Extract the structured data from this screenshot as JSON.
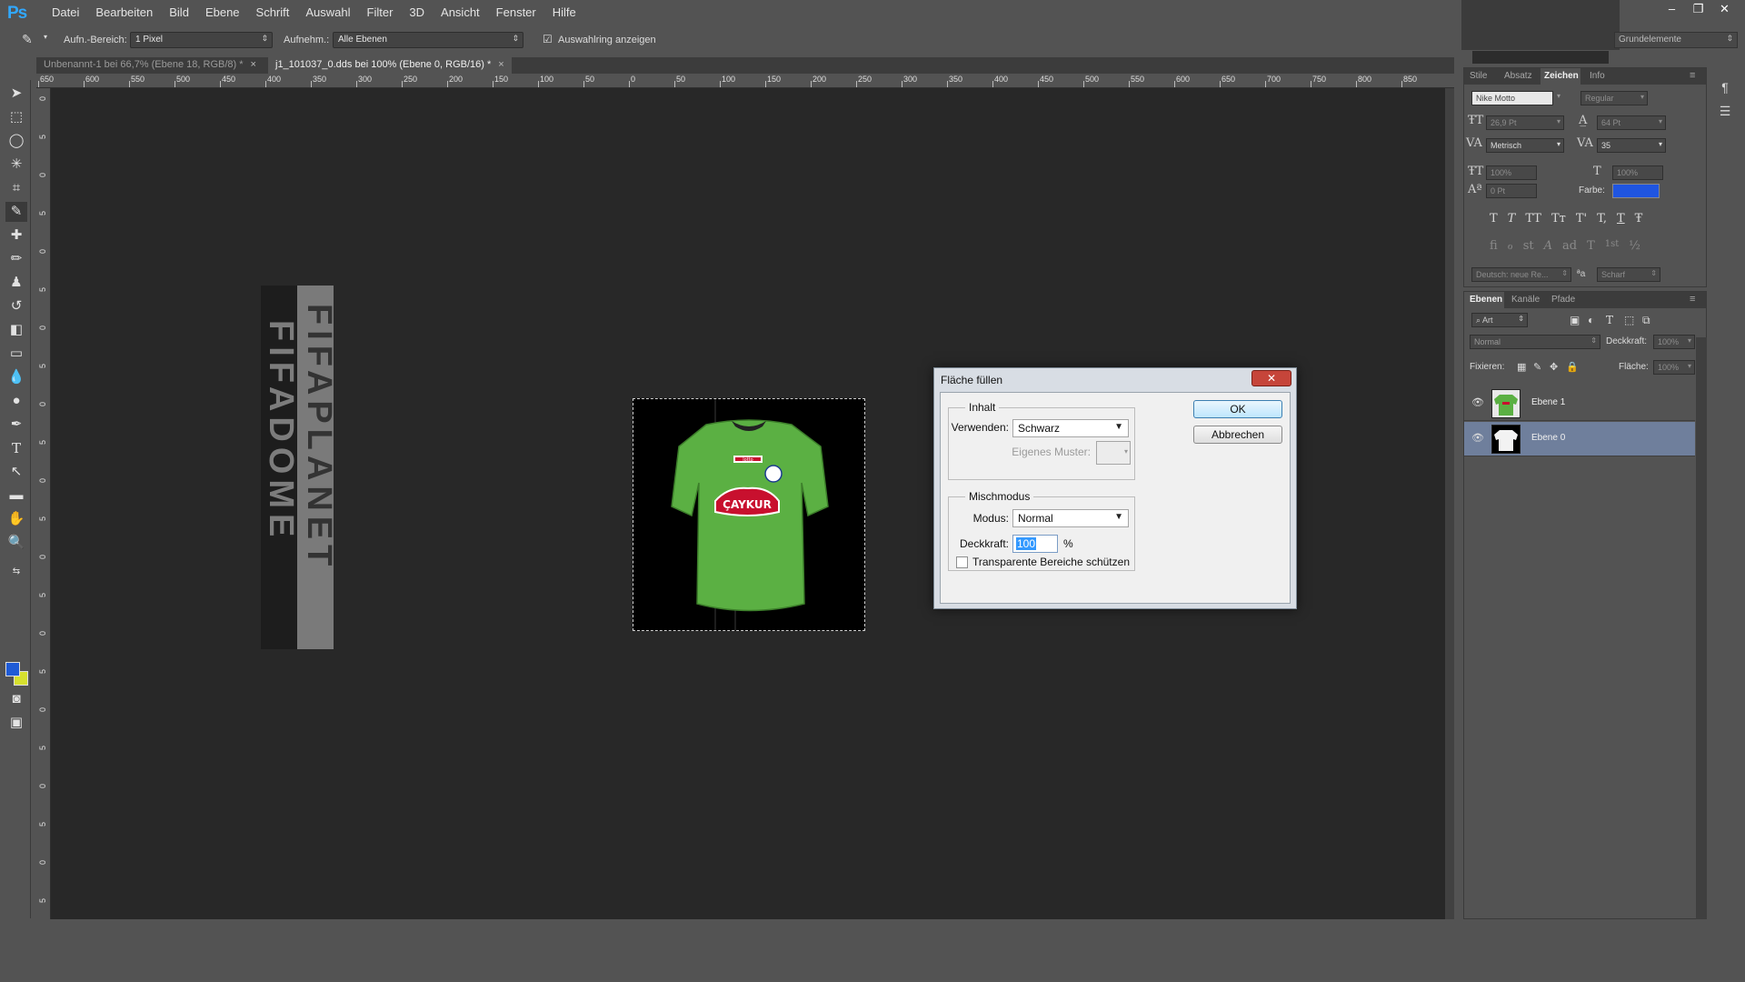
{
  "app": {
    "logo": "Ps"
  },
  "menu": [
    "Datei",
    "Bearbeiten",
    "Bild",
    "Ebene",
    "Schrift",
    "Auswahl",
    "Filter",
    "3D",
    "Ansicht",
    "Fenster",
    "Hilfe"
  ],
  "window_controls": [
    "–",
    "❐",
    "✕"
  ],
  "options": {
    "tool_icon": "eyedropper-icon",
    "sample_size_label": "Aufn.-Bereich:",
    "sample_size_value": "1 Pixel",
    "sample_label": "Aufnehm.:",
    "sample_value": "Alle Ebenen",
    "show_ring_label": "Auswahlring anzeigen",
    "workspace": "Grundelemente"
  },
  "doc_tabs": [
    {
      "label": "Unbenannt-1 bei 66,7% (Ebene 18, RGB/8) *",
      "close": "×"
    },
    {
      "label": "j1_101037_0.dds bei 100% (Ebene 0, RGB/16) *",
      "close": "×"
    }
  ],
  "ruler_h": [
    "650",
    "600",
    "550",
    "500",
    "450",
    "400",
    "350",
    "300",
    "250",
    "200",
    "150",
    "100",
    "50",
    "0",
    "50",
    "100",
    "150",
    "200",
    "250",
    "300",
    "350",
    "400",
    "450",
    "500",
    "550",
    "600",
    "650",
    "700",
    "750",
    "800",
    "850"
  ],
  "ruler_v": [
    "0",
    "5",
    "0",
    "5",
    "0",
    "5",
    "0",
    "5",
    "0",
    "5",
    "0",
    "5",
    "0",
    "5",
    "0",
    "5",
    "0",
    "5",
    "0",
    "5",
    "0",
    "5"
  ],
  "canvas_text": {
    "strip_1": "FIFADOME",
    "strip_2": "FIFAPLANET"
  },
  "jersey": {
    "sponsor": "ÇAYKUR",
    "brand": "lotto"
  },
  "character_panel": {
    "tabs": [
      "Stile",
      "Absatz",
      "Zeichen",
      "Info"
    ],
    "active_tab": "Zeichen",
    "font_family": "Nike Motto",
    "font_style": "Regular",
    "font_size": "26,9 Pt",
    "leading": "64 Pt",
    "kerning": "Metrisch",
    "tracking": "35",
    "vertical_scale": "100%",
    "horizontal_scale": "100%",
    "baseline_shift": "0 Pt",
    "color_label": "Farbe:",
    "color": "#1f55e0",
    "style_buttons": [
      "T",
      "T",
      "TT",
      "Tт",
      "T'",
      "T,",
      "T",
      "Ŧ"
    ],
    "opentype_buttons": [
      "ﬁ",
      "ℴ",
      "st",
      "A",
      "ad",
      "T",
      "1st",
      "½"
    ],
    "language": "Deutsch: neue Re...",
    "aa_label": "a",
    "antialias": "Scharf"
  },
  "layers_panel": {
    "tabs": [
      "Ebenen",
      "Kanäle",
      "Pfade"
    ],
    "active_tab": "Ebenen",
    "filter": "Art",
    "blend_mode": "Normal",
    "opacity_label": "Deckkraft:",
    "opacity": "100%",
    "lock_label": "Fixieren:",
    "fill_label": "Fläche:",
    "fill": "100%",
    "layers": [
      {
        "name": "Ebene 1",
        "selected": false
      },
      {
        "name": "Ebene 0",
        "selected": true
      }
    ]
  },
  "dialog": {
    "title": "Fläche füllen",
    "close": "✕",
    "content_group": "Inhalt",
    "use_label": "Verwenden:",
    "use_value": "Schwarz",
    "pattern_label": "Eigenes Muster:",
    "blend_group": "Mischmodus",
    "mode_label": "Modus:",
    "mode_value": "Normal",
    "opacity_label": "Deckkraft:",
    "opacity_value": "100",
    "percent": "%",
    "preserve_label": "Transparente Bereiche schützen",
    "ok": "OK",
    "cancel": "Abbrechen"
  }
}
